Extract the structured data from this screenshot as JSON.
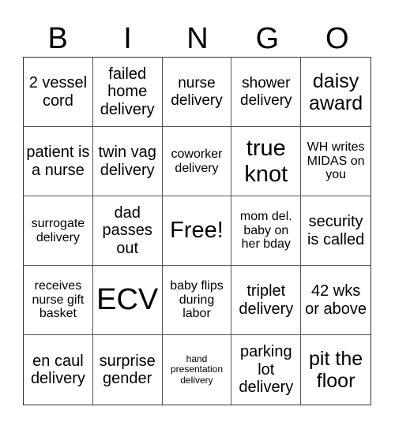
{
  "header": [
    "B",
    "I",
    "N",
    "G",
    "O"
  ],
  "cells": [
    "2 vessel cord",
    "failed home delivery",
    "nurse delivery",
    "shower delivery",
    "daisy award",
    "patient is a nurse",
    "twin vag delivery",
    "coworker delivery",
    "true knot",
    "WH writes MIDAS on you",
    "surrogate delivery",
    "dad passes out",
    "Free!",
    "mom del. baby on her bday",
    "security is called",
    "receives nurse gift basket",
    "ECV",
    "baby flips during labor",
    "triplet delivery",
    "42 wks or above",
    "en caul delivery",
    "surprise gender",
    "hand presentation delivery",
    "parking lot delivery",
    "pit the floor"
  ]
}
